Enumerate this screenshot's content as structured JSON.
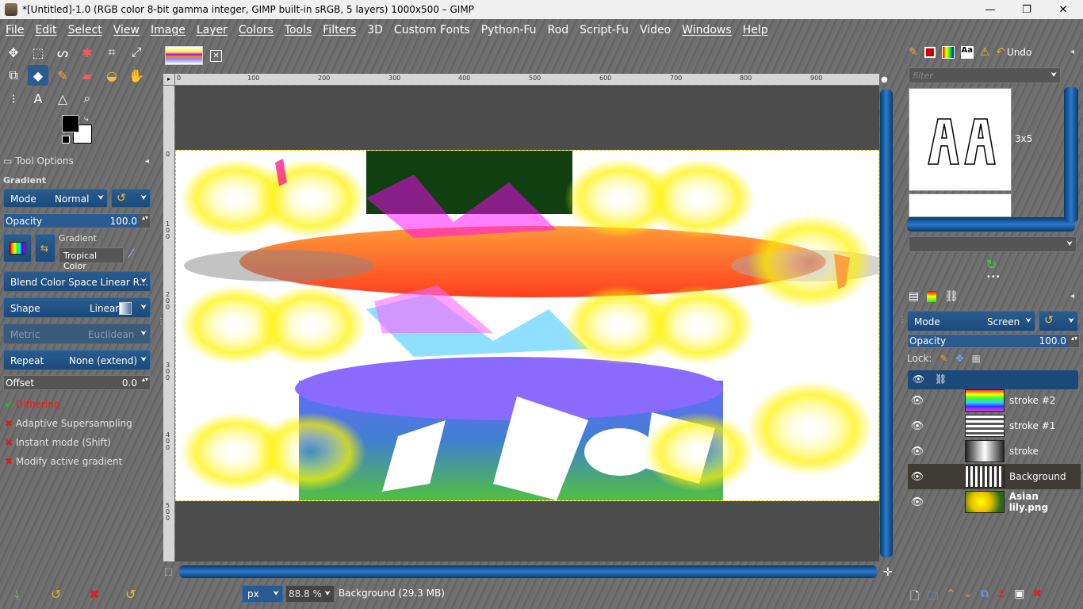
{
  "window": {
    "title": "*[Untitled]-1.0 (RGB color 8-bit gamma integer, GIMP built-in sRGB, 5 layers) 1000x500 – GIMP",
    "minimize": "—",
    "maximize": "❐",
    "close": "✕"
  },
  "menu": [
    "File",
    "Edit",
    "Select",
    "View",
    "Image",
    "Layer",
    "Colors",
    "Tools",
    "Filters",
    "3D",
    "Custom Fonts",
    "Python-Fu",
    "Rod",
    "Script-Fu",
    "Video",
    "Windows",
    "Help"
  ],
  "tool_options": {
    "title": "Tool Options",
    "section": "Gradient",
    "mode_label": "Mode",
    "mode_value": "Normal",
    "opacity_label": "Opacity",
    "opacity_value": "100.0",
    "gradient_label": "Gradient",
    "gradient_value": "Tropical Color",
    "blend_label": "Blend Color Space Linear R...",
    "shape_label": "Shape",
    "shape_value": "Linear",
    "metric_label": "Metric",
    "metric_value": "Euclidean",
    "repeat_label": "Repeat",
    "repeat_value": "None (extend)",
    "offset_label": "Offset",
    "offset_value": "0.0",
    "options": [
      {
        "label": "Dithering",
        "checked": true
      },
      {
        "label": "Adaptive Supersampling",
        "checked": false
      },
      {
        "label": "Instant mode  (Shift)",
        "checked": false
      },
      {
        "label": "Modify active gradient",
        "checked": false
      }
    ]
  },
  "ruler": {
    "h": [
      "0",
      "100",
      "200",
      "300",
      "400",
      "500",
      "600",
      "700",
      "800",
      "900"
    ],
    "v": [
      "0",
      "1\n0\n0",
      "2\n0\n0",
      "3\n0\n0",
      "4\n0\n0",
      "5\n0\n0"
    ]
  },
  "brushes": {
    "undo_label": "Undo",
    "filter_placeholder": "filter",
    "brush_size": "3x5"
  },
  "layers": {
    "mode_label": "Mode",
    "mode_value": "Screen",
    "opacity_label": "Opacity",
    "opacity_value": "100.0",
    "lock_label": "Lock:",
    "items": [
      {
        "name": "stroke #2",
        "selected": false,
        "bold": false
      },
      {
        "name": "stroke #1",
        "selected": false,
        "bold": false
      },
      {
        "name": "stroke",
        "selected": false,
        "bold": false
      },
      {
        "name": "Background",
        "selected": true,
        "bold": false
      },
      {
        "name": "Asian lily.png",
        "selected": false,
        "bold": true
      }
    ]
  },
  "status": {
    "unit": "px",
    "zoom": "88.8 %",
    "message": "Background (29.3 MB)"
  },
  "colors": {
    "accent": "#1b4a7a",
    "selection": "#e8d000",
    "error": "#d02020"
  }
}
